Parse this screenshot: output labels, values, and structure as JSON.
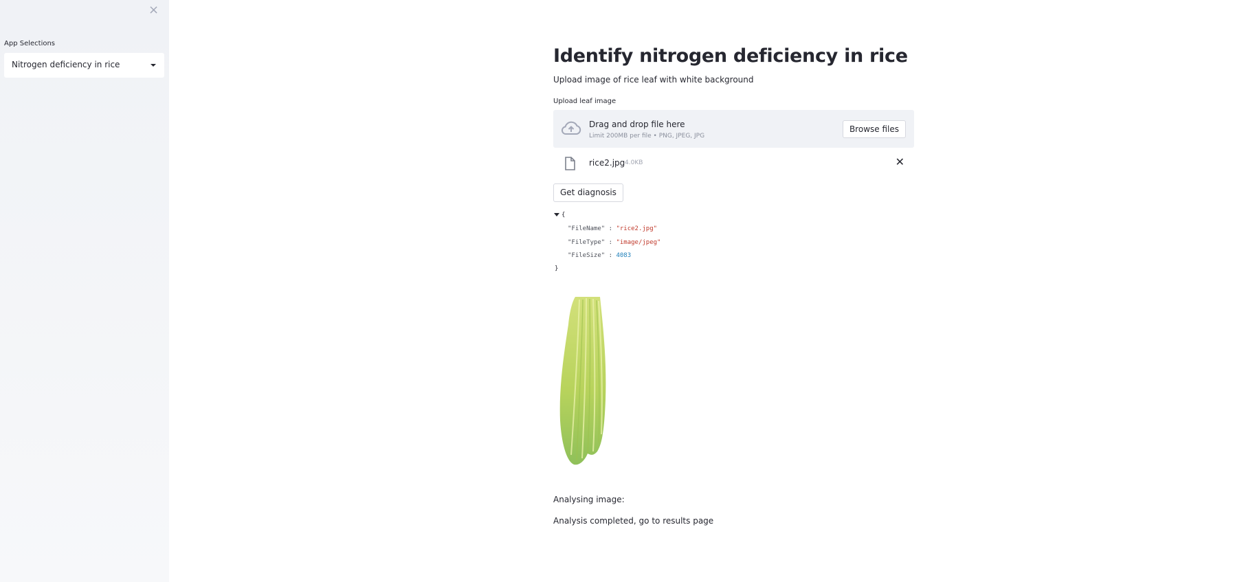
{
  "sidebar": {
    "close_glyph": "×",
    "label": "App Selections",
    "select_value": "Nitrogen deficiency in rice"
  },
  "main": {
    "title": "Identify nitrogen deficiency in rice",
    "subtitle": "Upload image of rice leaf with white background",
    "upload_label": "Upload leaf image",
    "dropzone": {
      "title": "Drag and drop file here",
      "subtitle": "Limit 200MB per file • PNG, JPEG, JPG",
      "browse_label": "Browse files",
      "icon": "cloud-upload-icon"
    },
    "file": {
      "name": "rice2.jpg",
      "size": "4.0KB",
      "icon": "file-icon",
      "remove_glyph": "✕"
    },
    "diagnosis_label": "Get diagnosis",
    "json_view": {
      "open": "{",
      "close": "}",
      "entries": [
        {
          "key": "\"FileName\"",
          "sep": " : ",
          "value": "\"rice2.jpg\""
        },
        {
          "key": "\"FileType\"",
          "sep": " : ",
          "value": "\"image/jpeg\""
        },
        {
          "key": "\"FileSize\"",
          "sep": " : ",
          "value": "4083"
        }
      ]
    },
    "status_analysing": "Analysing image:",
    "status_done": "Analysis completed, go to results page"
  },
  "colors": {
    "sidebar_bg": "#f0f2f6",
    "text": "#262730",
    "json_string": "#c0392b",
    "json_number": "#1e7fba",
    "leaf_green": "#b5d35a"
  }
}
